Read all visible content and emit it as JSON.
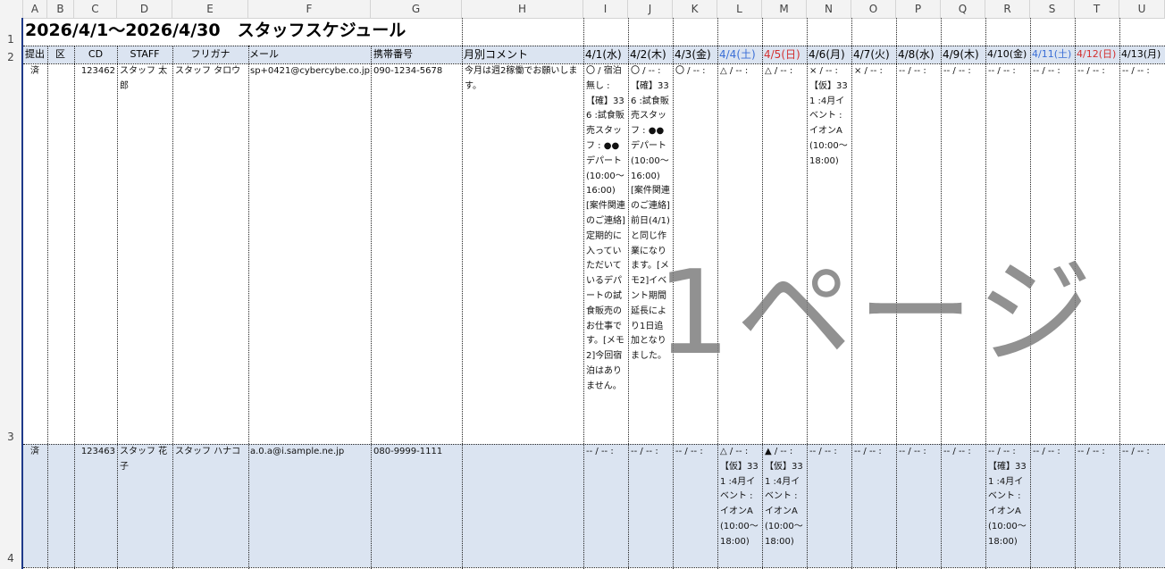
{
  "columns": [
    "A",
    "B",
    "C",
    "D",
    "E",
    "F",
    "G",
    "H",
    "I",
    "J",
    "K",
    "L",
    "M",
    "N",
    "O",
    "P",
    "Q",
    "R",
    "S",
    "T",
    "U"
  ],
  "rows": [
    "1",
    "2",
    "3",
    "4"
  ],
  "title": "2026/4/1～2026/4/30　スタッフスケジュール",
  "headers": {
    "submitted": "提出",
    "category": "区",
    "cd": "CD",
    "staff": "STAFF",
    "furigana": "フリガナ",
    "mail": "メール",
    "phone": "携帯番号",
    "comment": "月別コメント",
    "dates": [
      {
        "label": "4/1(水)",
        "color": "black"
      },
      {
        "label": "4/2(木)",
        "color": "black"
      },
      {
        "label": "4/3(金)",
        "color": "black"
      },
      {
        "label": "4/4(土)",
        "color": "blue"
      },
      {
        "label": "4/5(日)",
        "color": "red"
      },
      {
        "label": "4/6(月)",
        "color": "black"
      },
      {
        "label": "4/7(火)",
        "color": "black"
      },
      {
        "label": "4/8(水)",
        "color": "black"
      },
      {
        "label": "4/9(木)",
        "color": "black"
      },
      {
        "label": "4/10(金)",
        "color": "black"
      },
      {
        "label": "4/11(土)",
        "color": "blue"
      },
      {
        "label": "4/12(日)",
        "color": "red"
      },
      {
        "label": "4/13(月)",
        "color": "black"
      }
    ]
  },
  "staff": [
    {
      "submitted": "済",
      "category": "",
      "cd": "123462",
      "name": "スタッフ 太郎",
      "furigana": "スタッフ タロウ",
      "mail": "sp+0421@cybercybe.co.jp",
      "phone": "090-1234-5678",
      "comment": "今月は週2稼働でお願いします。",
      "days": [
        "〇 / 宿泊無し : 【確】336 :試食販売スタッフ : ●●デパート (10:00～16:00) [案件関連のご連絡]定期的に入っていただいているデパートの試食販売のお仕事です。[メモ2]今回宿泊はありません。",
        "〇 / -- : 【確】336 :試食販売スタッフ : ●●デパート (10:00～16:00) [案件関連のご連絡]前日(4/1)と同じ作業になります。[メモ2]イベント期間延長により1日追加となりました。",
        "〇 / -- :",
        "△ / -- :",
        "△ / -- :",
        "× / -- : 【仮】331 :4月イベント :イオンA (10:00～18:00)",
        "× / -- :",
        "-- / -- :",
        "-- / -- :",
        "-- / -- :",
        "-- / -- :",
        "-- / -- :",
        "-- / -- :"
      ]
    },
    {
      "submitted": "済",
      "category": "",
      "cd": "123463",
      "name": "スタッフ 花子",
      "furigana": "スタッフ ハナコ",
      "mail": "a.0.a@i.sample.ne.jp",
      "phone": "080-9999-1111",
      "comment": "",
      "days": [
        "-- / -- :",
        "-- / -- :",
        "-- / -- :",
        "△ / -- : 【仮】331 :4月イベント :イオンA (10:00～18:00)",
        "▲ / -- : 【仮】331 :4月イベント :イオンA (10:00～18:00)",
        "-- / -- :",
        "-- / -- :",
        "-- / -- :",
        "-- / -- :",
        "-- / -- : 【確】331 :4月イベント :イオンA (10:00～18:00)",
        "-- / -- :",
        "-- / -- :",
        "-- / -- :"
      ]
    }
  ],
  "watermark": "1ページ",
  "colors": {
    "blue": "#3a6ed6",
    "red": "#d32f2f",
    "rowHighlight": "#dbe4f1",
    "selection": "#1f3a8a"
  }
}
